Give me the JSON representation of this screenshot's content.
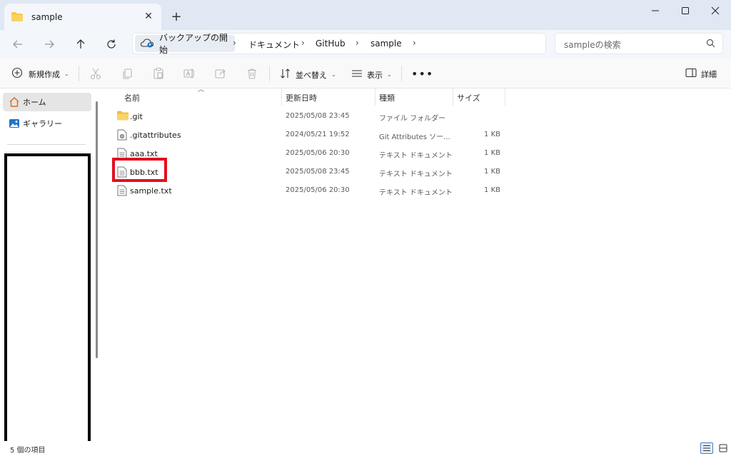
{
  "window": {
    "tab_title": "sample",
    "new_tab_glyph": "+",
    "close_tab_glyph": "✕",
    "minimize_glyph": "—",
    "maximize_glyph": "☐",
    "close_glyph": "✕"
  },
  "navigation": {
    "back_glyph": "←",
    "forward_glyph": "→",
    "up_glyph": "↑",
    "refresh_glyph": "↻",
    "breadcrumbs": [
      "バックアップの開始",
      "ドキュメント",
      "GitHub",
      "sample"
    ],
    "separator_glyph": "›",
    "search_placeholder": "sampleの検索"
  },
  "toolbar": {
    "new_label": "新規作成",
    "sort_label": "並べ替え",
    "view_label": "表示",
    "more_label": "•••",
    "details_label": "詳細",
    "dropdown_glyph": "⌄"
  },
  "sidebar": {
    "items": [
      {
        "label": "ホーム",
        "icon": "home-icon"
      },
      {
        "label": "ギャラリー",
        "icon": "gallery-icon"
      }
    ]
  },
  "columns": {
    "name": "名前",
    "modified": "更新日時",
    "type": "種類",
    "size": "サイズ"
  },
  "files": [
    {
      "name": ".git",
      "modified": "2025/05/08 23:45",
      "type": "ファイル フォルダー",
      "size": "",
      "icon": "folder-icon"
    },
    {
      "name": ".gitattributes",
      "modified": "2024/05/21 19:52",
      "type": "Git Attributes ソー...",
      "size": "1 KB",
      "icon": "settings-file-icon"
    },
    {
      "name": "aaa.txt",
      "modified": "2025/05/06 20:30",
      "type": "テキスト ドキュメント",
      "size": "1 KB",
      "icon": "text-file-icon"
    },
    {
      "name": "bbb.txt",
      "modified": "2025/05/08 23:45",
      "type": "テキスト ドキュメント",
      "size": "1 KB",
      "icon": "text-file-icon"
    },
    {
      "name": "sample.txt",
      "modified": "2025/05/06 20:30",
      "type": "テキスト ドキュメント",
      "size": "1 KB",
      "icon": "text-file-icon"
    }
  ],
  "status": {
    "item_count": "5 個の項目"
  },
  "colors": {
    "accent": "#0a6ccf",
    "highlight_box": "#e3101d",
    "folder": "#f7c948"
  }
}
